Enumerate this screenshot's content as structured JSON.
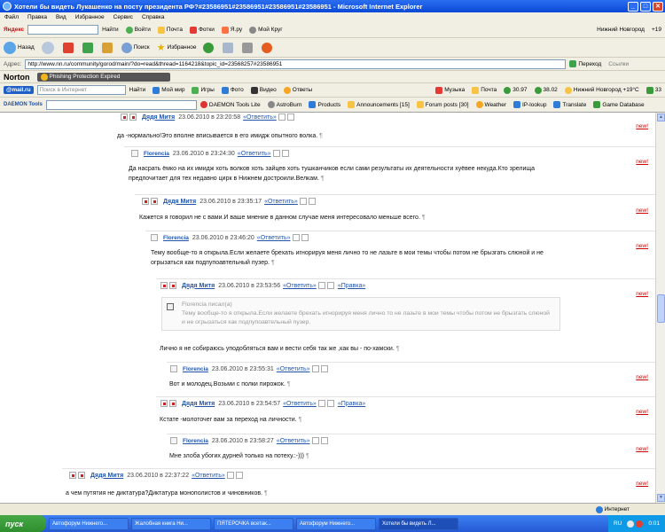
{
  "window": {
    "title": "Хотели бы видеть Лукашенко на посту президента РФ?#23586951#23586951#23586951#23586951 - Microsoft Internet Explorer"
  },
  "menu": [
    "Файл",
    "Правка",
    "Вид",
    "Избранное",
    "Сервис",
    "Справка"
  ],
  "yandex_bar": {
    "logo": "Яндекс",
    "find_label": "Найти",
    "items": [
      "Войти",
      "Почта",
      "Фотки",
      "Я.ру",
      "Мой Круг"
    ],
    "city": "Нижний Новгород",
    "temp": "+19"
  },
  "ie_nav": {
    "back": "Назад",
    "search": "Поиск",
    "favorites": "Избранное"
  },
  "address_bar": {
    "label": "Адрес:",
    "url": "http://www.nn.ru/community/gorod/main/?do=read&thread=1164218&topic_id=23568257#23586951",
    "go": "Переход",
    "links": "Ссылки"
  },
  "norton": {
    "logo": "Norton",
    "badge": "Phishing Protection Expired"
  },
  "mailru_bar": {
    "logo": "@mail.ru",
    "search_placeholder": "Поиск в Интернет",
    "find": "Найти",
    "items": [
      "Мой мир",
      "Игры",
      "Фото",
      "Видео",
      "Ответы"
    ],
    "music": "Музыка",
    "mail": "Почта",
    "rate1": "30.97",
    "rate2": "38.02",
    "weather": "Нижний Новгород +19°C",
    "counter": "33"
  },
  "daemon_bar": {
    "logo": "DAEMON Tools",
    "items": [
      "DAEMON Tools Lite",
      "AstroBurn",
      "Products",
      "Announcements [15]",
      "Forum posts [30]",
      "Weather",
      "IP-lookup",
      "Translate",
      "Game Database"
    ]
  },
  "comments": [
    {
      "author": "Дядя Митя",
      "date": "23.06.2010 в 23:20:58",
      "reply": "«Ответить»",
      "new": "new!",
      "text": "да -нормально!Это вполне вписывается в его имидж опытного волка."
    },
    {
      "author": "Florencia",
      "date": "23.06.2010 в 23:24:30",
      "reply": "«Ответить»",
      "new": "new!",
      "text": "Да насрать ёмко на их имидж хоть волков хоть зайцев хоть тушканчиков если сами результаты их деятельности хуёвее некуда.Кто зрелища предпочитает для тех недавно цирк в Нижнем достроили.Велкам."
    },
    {
      "author": "Дядя Митя",
      "date": "23.06.2010 в 23:35:17",
      "reply": "«Ответить»",
      "new": "new!",
      "text": "Кажется я говорил не с вами.И ваше мнение в данном случае меня интересовало меньше всего."
    },
    {
      "author": "Florencia",
      "date": "23.06.2010 в 23:46:20",
      "reply": "«Ответить»",
      "new": "new!",
      "text": "Тему вообще-то я открыла.Если желаете брехать игнорируя меня лично то не лазьте в мои темы чтобы потом не брызгать слюной и не огрызаться как подпупоавтельный пузер."
    },
    {
      "author": "Дядя Митя",
      "date": "23.06.2010 в 23:53:56",
      "reply": "«Ответить»",
      "edit": "«Правка»",
      "new": "new!",
      "quote_head": "Florencia писал(а)",
      "quote_text": "Тему вообще-то я открыла.Если желаете брехать игнорируя меня лично то не лазьте в мои темы чтобы потом не брызгать слюной и не огрызаться как подпупоавтельный пузер.",
      "text": "Лично я не собираюсь уподобляться вам и вести себя так же ,как вы - по-хамски."
    },
    {
      "author": "Florencia",
      "date": "23.06.2010 в 23:55:31",
      "reply": "«Ответить»",
      "new": "new!",
      "text": "Вот и молодец.Возьми с полки пирожок."
    },
    {
      "author": "Дядя Митя",
      "date": "23.06.2010 в 23:54:57",
      "reply": "«Ответить»",
      "edit": "«Правка»",
      "new": "new!",
      "text": "Кстате -молоточег вам за переход на личности."
    },
    {
      "author": "Florencia",
      "date": "23.06.2010 в 23:58:27",
      "reply": "«Ответить»",
      "new": "new!",
      "text": "Мне злоба убогих дурней только на потеху.:-)))"
    },
    {
      "author": "Дядя Митя",
      "date": "23.06.2010 в 22:37:22",
      "reply": "«Ответить»",
      "new": "new!",
      "text": "а чем путятия не диктатура?Диктатура монополистов и чиновников."
    }
  ],
  "pilcrow": "¶",
  "status": {
    "zone": "Интернет"
  },
  "taskbar": {
    "start": "пуск",
    "tasks": [
      "Автофорум Нижнего...",
      "Жалобная книга Ни...",
      "ПЯТЕРОЧКА всетак...",
      "Автофорум Нижнего...",
      "Хотели бы видеть Л..."
    ],
    "lang": "RU",
    "clock": "0:01"
  },
  "colors": {
    "title_blue": "#0a48d6",
    "link_blue": "#2255aa",
    "new_red": "#cc0000",
    "taskbar_blue": "#2559d4"
  }
}
